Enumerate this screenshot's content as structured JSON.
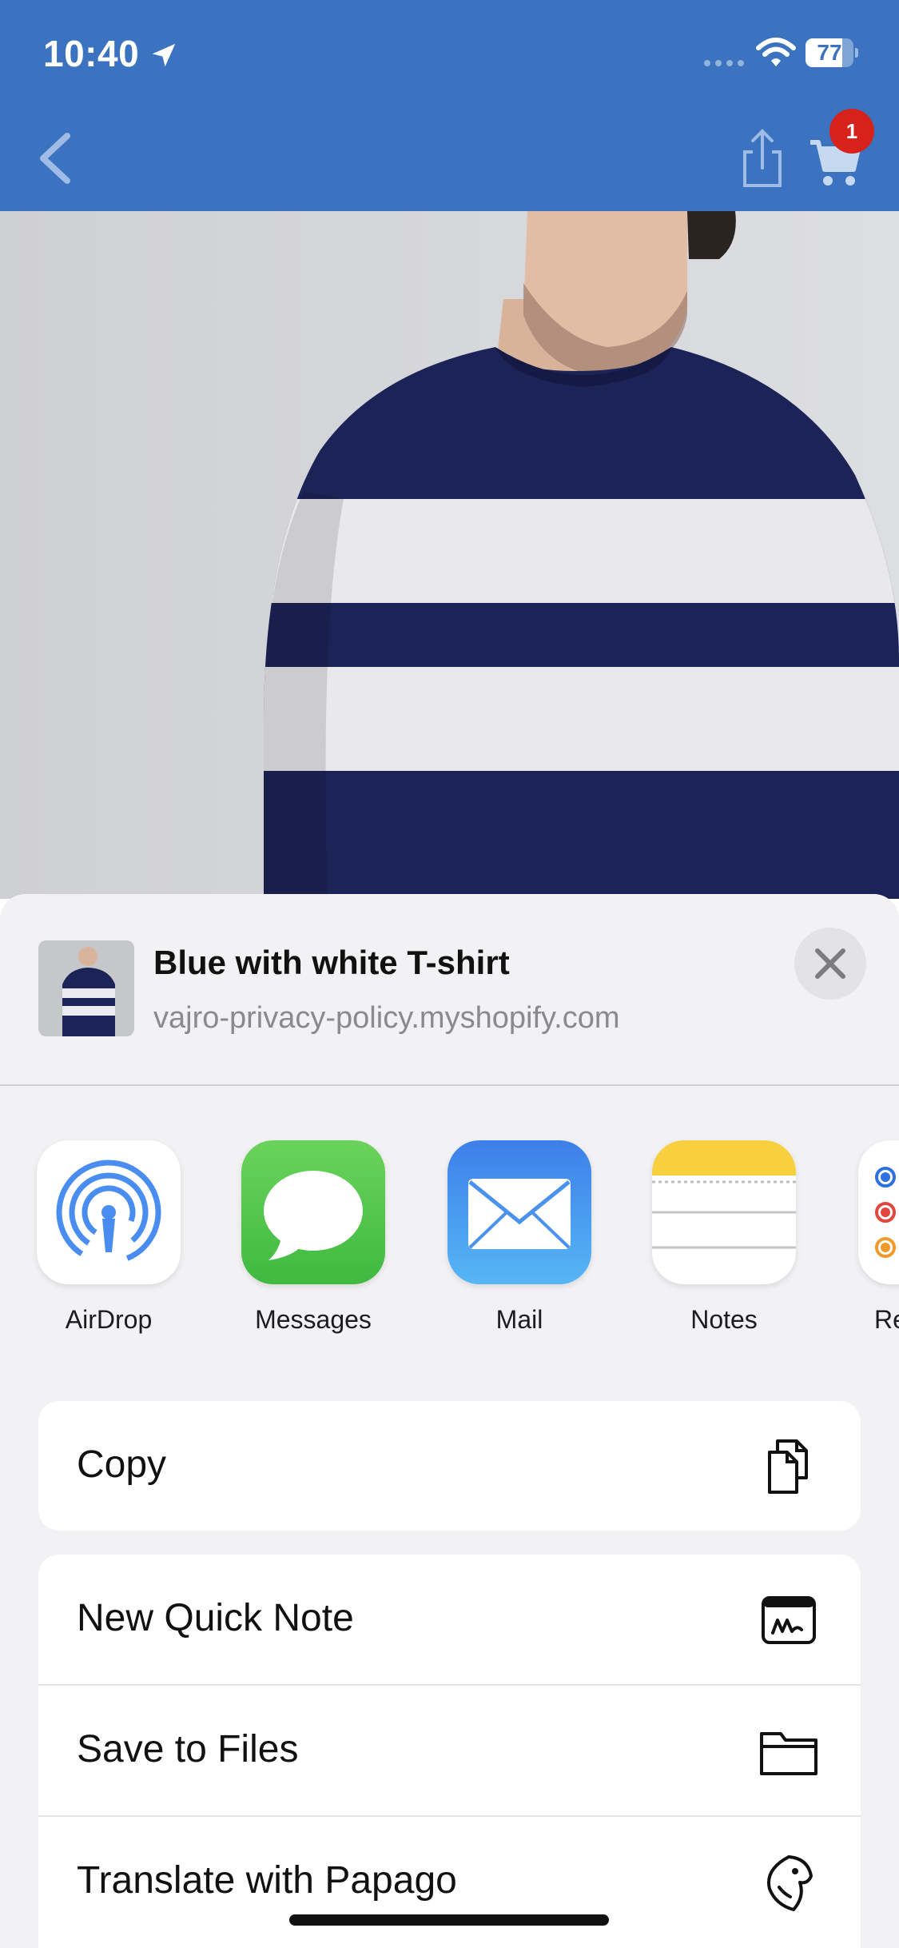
{
  "status_bar": {
    "time": "10:40",
    "battery": "77"
  },
  "nav": {
    "cart_badge": "1"
  },
  "share_sheet": {
    "title": "Blue with white T-shirt",
    "subtitle": "vajro-privacy-policy.myshopify.com",
    "apps": [
      {
        "label": "AirDrop",
        "icon": "airdrop-icon"
      },
      {
        "label": "Messages",
        "icon": "messages-icon"
      },
      {
        "label": "Mail",
        "icon": "mail-icon"
      },
      {
        "label": "Notes",
        "icon": "notes-icon"
      },
      {
        "label": "Rer",
        "icon": "reminders-icon"
      }
    ],
    "action_groups": [
      [
        {
          "label": "Copy",
          "icon": "copy-icon"
        }
      ],
      [
        {
          "label": "New Quick Note",
          "icon": "quick-note-icon"
        },
        {
          "label": "Save to Files",
          "icon": "folder-icon"
        },
        {
          "label": "Translate with Papago",
          "icon": "papago-icon"
        }
      ]
    ]
  },
  "colors": {
    "app_bar": "#3b73c1",
    "badge": "#d7221c",
    "shirt_navy": "#1c2457",
    "shirt_white": "#e9e9ec"
  }
}
